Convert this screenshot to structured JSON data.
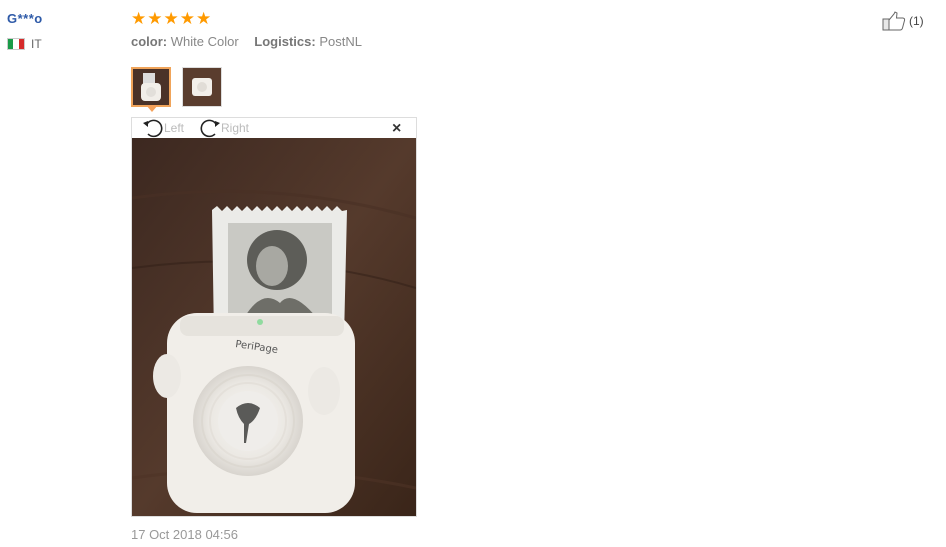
{
  "review": {
    "user_name": "G***o",
    "country_code": "IT",
    "rating": 5,
    "color_key": "color:",
    "color_value": "White Color",
    "logistics_key": "Logistics:",
    "logistics_value": "PostNL",
    "likes": "(1)",
    "date": "17 Oct 2018 04:56"
  },
  "viewer": {
    "rotate_left": "Left",
    "rotate_right": "Right",
    "close": "×",
    "product_brand": "PeriPage"
  },
  "colors": {
    "name": "#2e5aa8",
    "star": "#ff9a00",
    "thumb_active_border": "#f0a45a"
  },
  "icons": [
    "italy-flag-icon",
    "star-icon",
    "thumbs-up-icon",
    "rotate-left-icon",
    "rotate-right-icon",
    "close-icon"
  ]
}
